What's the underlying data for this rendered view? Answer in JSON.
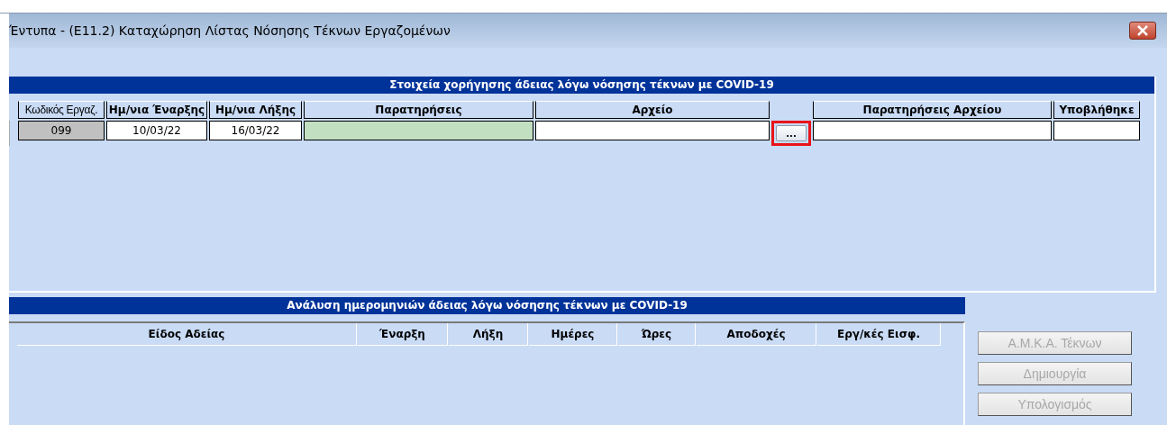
{
  "window": {
    "title": "Έντυπα - (Ε11.2) Καταχώρηση Λίστας Νόσησης Τέκνων Εργαζομένων"
  },
  "leave_grid": {
    "header": "Στοιχεία χορήγησης άδειας λόγω νόσησης τέκνων με COVID-19",
    "columns": [
      "Κωδικός Εργαζ.",
      "Ημ/νια Έναρξης",
      "Ημ/νια Λήξης",
      "Παρατηρήσεις",
      "Αρχείο",
      "",
      "Παρατηρήσεις Αρχείου",
      "Υποβλήθηκε"
    ],
    "rows": [
      {
        "cells": [
          {
            "kind": "readonly",
            "text": "099"
          },
          {
            "kind": "text",
            "text": "10/03/22"
          },
          {
            "kind": "text",
            "text": "16/03/22"
          },
          {
            "kind": "active",
            "text": ""
          },
          {
            "kind": "text",
            "text": ""
          },
          {
            "kind": "browse",
            "text": "...",
            "highlighted": true
          },
          {
            "kind": "text",
            "text": ""
          },
          {
            "kind": "text",
            "text": ""
          }
        ]
      }
    ]
  },
  "dates_grid": {
    "header": "Ανάλυση ημερομηνιών άδειας λόγω νόσησης τέκνων με COVID-19",
    "columns": [
      "Είδος Αδείας",
      "Έναρξη",
      "Λήξη",
      "Ημέρες",
      "Ώρες",
      "Αποδοχές",
      "Εργ/κές Εισφ."
    ]
  },
  "buttons": [
    {
      "label": "Α.Μ.Κ.Α. Τέκνων",
      "disabled": true
    },
    {
      "label": "Δημιουργία",
      "disabled": true
    },
    {
      "label": "Υπολογισμός",
      "disabled": true
    }
  ]
}
